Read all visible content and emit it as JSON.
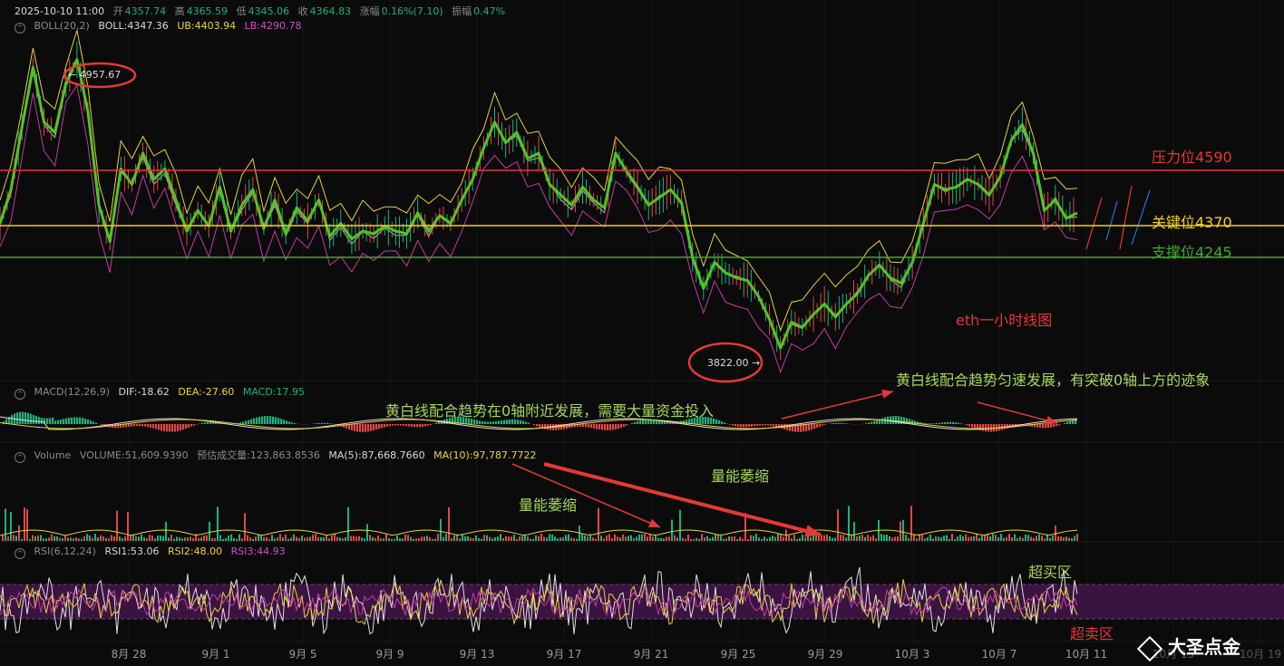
{
  "header": {
    "datetime": "2025-10-10 11:00",
    "open_label": "开",
    "open": "4357.74",
    "high_label": "高",
    "high": "4365.59",
    "low_label": "低",
    "low": "4345.06",
    "close_label": "收",
    "close": "4364.83",
    "change_label": "涨幅",
    "change": "0.16%(7.10)",
    "amp_label": "振幅",
    "amp": "0.47%"
  },
  "boll": {
    "label": "BOLL(20,2)",
    "mid": "BOLL:4347.36",
    "ub": "UB:4403.94",
    "lb": "LB:4290.78"
  },
  "macd": {
    "label": "MACD(12,26,9)",
    "dif": "DIF:-18.62",
    "dea": "DEA:-27.60",
    "macd": "MACD:17.95"
  },
  "volume": {
    "label": "Volume",
    "vol": "VOLUME:51,609.9390",
    "est": "预估成交量:123,863.8536",
    "ma5": "MA(5):87,668.7660",
    "ma10": "MA(10):97,787.7722"
  },
  "rsi": {
    "label": "RSI(6,12,24)",
    "rsi1": "RSI1:53.06",
    "rsi2": "RSI2:48.00",
    "rsi3": "RSI3:44.93"
  },
  "colors": {
    "bg": "#0b0b0b",
    "up": "#19b37e",
    "down": "#e04848",
    "price_line": "#55c225",
    "ub": "#e6d23a",
    "mid": "#b8b8b8",
    "lb": "#c43aa8",
    "resistance": "#e53935",
    "key": "#f2cf1d",
    "support": "#43a82c",
    "rsi_zone": "#3a1440",
    "annot": "#a4d65a"
  },
  "chart_data": {
    "type": "line",
    "title": "eth一小时线图",
    "x_ticks": [
      "8月 28",
      "9月 1",
      "9月 5",
      "9月 9",
      "9月 13",
      "9月 17",
      "9月 21",
      "9月 25",
      "9月 29",
      "10月 3",
      "10月 7",
      "10月 11",
      "10月 15",
      "10月 19"
    ],
    "price_points": [
      [
        0,
        4330
      ],
      [
        1,
        4460
      ],
      [
        2,
        4700
      ],
      [
        3,
        4930
      ],
      [
        4,
        4720
      ],
      [
        5,
        4680
      ],
      [
        6,
        4870
      ],
      [
        7,
        4960
      ],
      [
        8,
        4760
      ],
      [
        9,
        4400
      ],
      [
        10,
        4260
      ],
      [
        11,
        4540
      ],
      [
        12,
        4480
      ],
      [
        13,
        4600
      ],
      [
        14,
        4500
      ],
      [
        15,
        4540
      ],
      [
        16,
        4420
      ],
      [
        17,
        4300
      ],
      [
        18,
        4380
      ],
      [
        19,
        4320
      ],
      [
        20,
        4470
      ],
      [
        21,
        4300
      ],
      [
        22,
        4400
      ],
      [
        23,
        4460
      ],
      [
        24,
        4310
      ],
      [
        25,
        4420
      ],
      [
        26,
        4290
      ],
      [
        27,
        4390
      ],
      [
        28,
        4340
      ],
      [
        29,
        4420
      ],
      [
        30,
        4280
      ],
      [
        31,
        4330
      ],
      [
        32,
        4270
      ],
      [
        33,
        4300
      ],
      [
        34,
        4290
      ],
      [
        35,
        4320
      ],
      [
        36,
        4300
      ],
      [
        37,
        4290
      ],
      [
        38,
        4370
      ],
      [
        39,
        4300
      ],
      [
        40,
        4360
      ],
      [
        41,
        4330
      ],
      [
        42,
        4420
      ],
      [
        43,
        4500
      ],
      [
        44,
        4620
      ],
      [
        45,
        4720
      ],
      [
        46,
        4640
      ],
      [
        47,
        4680
      ],
      [
        48,
        4580
      ],
      [
        49,
        4600
      ],
      [
        50,
        4480
      ],
      [
        51,
        4440
      ],
      [
        52,
        4400
      ],
      [
        53,
        4470
      ],
      [
        54,
        4420
      ],
      [
        55,
        4390
      ],
      [
        56,
        4600
      ],
      [
        57,
        4530
      ],
      [
        58,
        4470
      ],
      [
        59,
        4400
      ],
      [
        60,
        4430
      ],
      [
        61,
        4460
      ],
      [
        62,
        4410
      ],
      [
        63,
        4200
      ],
      [
        64,
        4080
      ],
      [
        65,
        4180
      ],
      [
        66,
        4140
      ],
      [
        67,
        4120
      ],
      [
        68,
        4110
      ],
      [
        69,
        4050
      ],
      [
        70,
        3960
      ],
      [
        71,
        3850
      ],
      [
        72,
        3950
      ],
      [
        73,
        3930
      ],
      [
        74,
        3980
      ],
      [
        75,
        4020
      ],
      [
        76,
        3970
      ],
      [
        77,
        4020
      ],
      [
        78,
        4060
      ],
      [
        79,
        4130
      ],
      [
        80,
        4170
      ],
      [
        81,
        4120
      ],
      [
        82,
        4100
      ],
      [
        83,
        4180
      ],
      [
        84,
        4330
      ],
      [
        85,
        4480
      ],
      [
        86,
        4460
      ],
      [
        87,
        4470
      ],
      [
        88,
        4500
      ],
      [
        89,
        4480
      ],
      [
        90,
        4440
      ],
      [
        91,
        4510
      ],
      [
        92,
        4650
      ],
      [
        93,
        4710
      ],
      [
        94,
        4600
      ],
      [
        95,
        4380
      ],
      [
        96,
        4420
      ],
      [
        97,
        4350
      ],
      [
        98,
        4370
      ]
    ],
    "resistance": {
      "label": "压力位4590",
      "value": 4590
    },
    "key_level": {
      "label": "关键位4370",
      "value": 4370
    },
    "support": {
      "label": "支撑位4245",
      "value": 4245
    },
    "high_marker": {
      "label": "← 4957.67",
      "value": 4957.67
    },
    "low_marker": {
      "label": "3822.00 →",
      "value": 3822.0
    },
    "annotations": [
      "黄白线配合趋势在0轴附近发展，需要大量资金投入",
      "黄白线配合趋势匀速发展，有突破0轴上方的迹象",
      "量能萎缩",
      "量能萎缩",
      "超买区",
      "超卖区"
    ]
  },
  "watermark": "大圣点金"
}
